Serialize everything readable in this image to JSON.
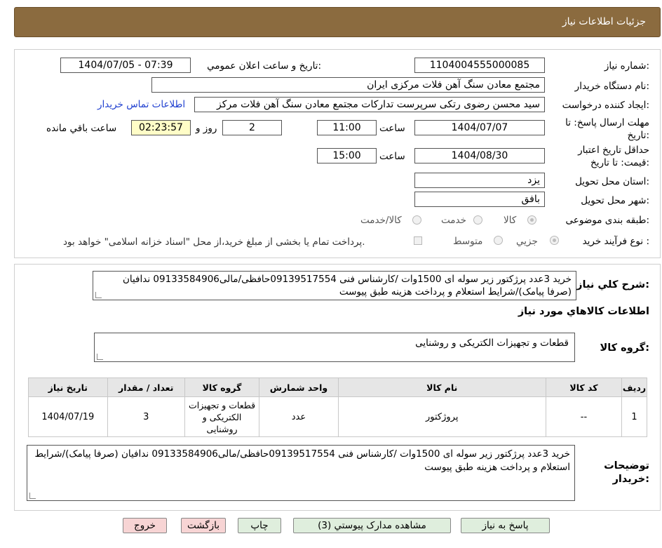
{
  "header": {
    "title": "جزئیات اطلاعات نیاز"
  },
  "form": {
    "need_number": {
      "label": "شماره نیاز:",
      "value": "1104004555000085"
    },
    "announce": {
      "label": "تاریخ و ساعت اعلان عمومي:",
      "value": "1404/07/05 - 07:39"
    },
    "buyer_org": {
      "label": "نام دستگاه خريدار:",
      "value": "مجتمع معادن سنگ آهن فلات مرکزی ایران"
    },
    "requester": {
      "label": "ایجاد کننده درخواست:",
      "value": "سید محسن رضوی رتکی سرپرست تدارکات مجتمع معادن سنگ آهن فلات مرکز",
      "contact_link": "اطلاعات تماس خریدار"
    },
    "deadline": {
      "label": "مهلت ارسال پاسخ: تا تاریخ:",
      "date": "1404/07/07",
      "time_label": "ساعت",
      "time": "11:00",
      "days": "2",
      "days_label": "روز و",
      "remaining": "02:23:57",
      "remaining_label": "ساعت باقي مانده"
    },
    "validity": {
      "label": "حداقل تاریخ اعتبار قیمت: تا تاریخ:",
      "date": "1404/08/30",
      "time_label": "ساعت",
      "time": "15:00"
    },
    "province": {
      "label": "استان محل تحویل:",
      "value": "یزد"
    },
    "city": {
      "label": "شهر محل تحویل:",
      "value": "بافق"
    },
    "category": {
      "label": "طبقه بندی موضوعی:",
      "options": [
        "کالا",
        "خدمت",
        "کالا/خدمت"
      ]
    },
    "purchase_type": {
      "label": "نوع فرآیند خرید :",
      "options": [
        "جزیي",
        "متوسط"
      ],
      "note": "پرداخت تمام یا بخشی از مبلغ خرید،از محل \"اسناد خزانه اسلامی\" خواهد بود."
    }
  },
  "summary": {
    "label": "شرح کلي نياز:",
    "text": "خرید 3عدد پرژکتور زیر سوله ای 1500وات /کارشناس فنی 09139517554حافظی/مالی09133584906 ندافیان (صرفا پیامک)/شرایط استعلام و پرداخت هزینه طبق پیوست"
  },
  "goods": {
    "section_title": "اطلاعات کالاهاي مورد نياز",
    "group_label": "گروه کالا:",
    "group_value": "قطعات و تجهیزات الکتریکی و روشنایی",
    "table": {
      "headers": [
        "رديف",
        "کد کالا",
        "نام کالا",
        "واحد شمارش",
        "گروه کالا",
        "تعداد / مقدار",
        "تاریخ نیاز"
      ],
      "rows": [
        [
          "1",
          "--",
          "پروژکتور",
          "عدد",
          "قطعات و تجهیزات الکتریکی و روشنایی",
          "3",
          "1404/07/19"
        ]
      ]
    },
    "buyer_notes_label": "توضیحات خریدار:",
    "buyer_notes": "خرید 3عدد پرژکتور زیر سوله ای 1500وات /کارشناس فنی 09139517554حافظی/مالی09133584906 ندافیان (صرفا پیامک)/شرایط استعلام و پرداخت هزینه طبق پیوست"
  },
  "buttons": {
    "reply": "پاسخ به نیاز",
    "attachments": "مشاهده مدارک پیوستي (3)",
    "print": "چاپ",
    "back": "بازگشت",
    "exit": "خروج"
  },
  "colors": {
    "header": "#8b6b3f",
    "timer": "#fffdc7",
    "button_green": "#dfeedd",
    "button_pink": "#f7d4d4",
    "link": "#1f3fd0"
  }
}
